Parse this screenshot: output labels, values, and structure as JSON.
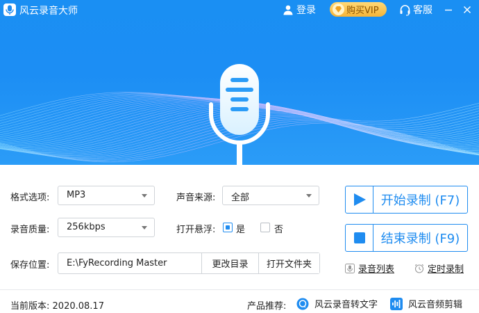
{
  "app": {
    "title": "风云录音大师"
  },
  "header": {
    "login_label": "登录",
    "vip_label": "购买VIP",
    "service_label": "客服"
  },
  "settings": {
    "format": {
      "label": "格式选项:",
      "value": "MP3"
    },
    "source": {
      "label": "声音来源:",
      "value": "全部"
    },
    "quality": {
      "label": "录音质量:",
      "value": "256kbps"
    },
    "float": {
      "label": "打开悬浮:",
      "yes_label": "是",
      "no_label": "否",
      "yes_checked": true
    },
    "save": {
      "label": "保存位置:",
      "path": "E:\\FyRecording Master",
      "change_dir_label": "更改目录",
      "open_folder_label": "打开文件夹"
    }
  },
  "actions": {
    "start_label": "开始录制 (F7)",
    "stop_label": "结束录制 (F9)",
    "list_label": "录音列表",
    "timer_label": "定时录制"
  },
  "footer": {
    "version_label": "当前版本:",
    "version": "2020.08.17",
    "recommend_label": "产品推荐:",
    "product1": "风云录音转文字",
    "product2": "风云音频剪辑"
  },
  "colors": {
    "accent": "#1f8cf0",
    "header_bg": "#1c8ef4",
    "vip_gold": "#f5b437"
  }
}
